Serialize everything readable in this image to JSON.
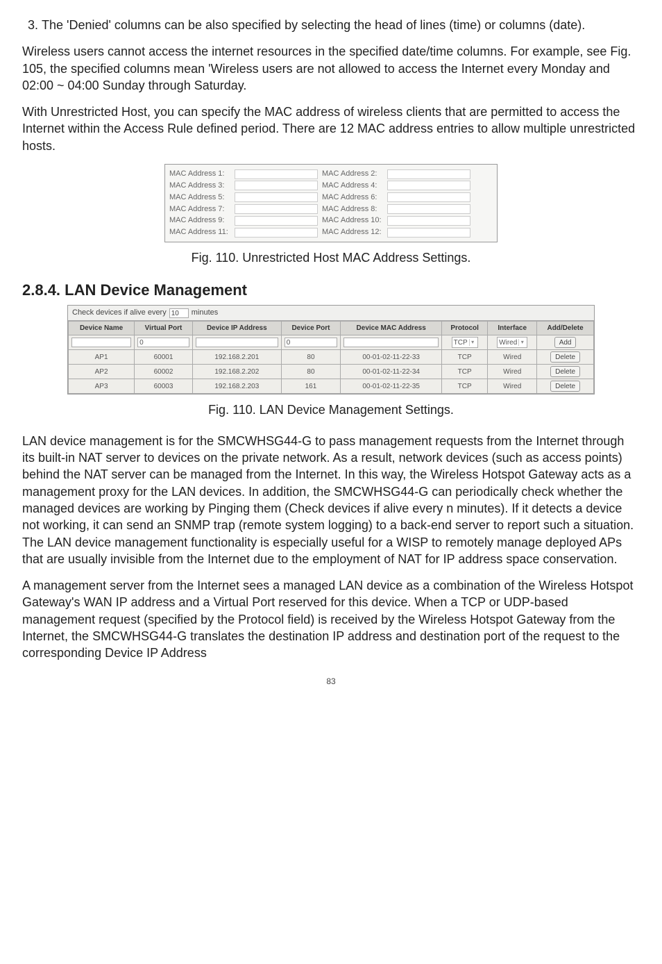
{
  "list_item_3": "The 'Denied' columns can be also specified by selecting the head of lines (time) or columns (date).",
  "para1": "Wireless users cannot access the internet resources in the specified date/time columns. For example, see Fig. 105, the specified columns mean 'Wireless users are not allowed to access the Internet every Monday and 02:00 ~ 04:00 Sunday through Saturday.",
  "para2": "With Unrestricted Host, you can specify the MAC address of wireless clients that are permitted to access the Internet within the Access Rule defined period. There are 12 MAC address entries to allow multiple unrestricted hosts.",
  "mac_labels": {
    "l1": "MAC Address 1:",
    "r1": "MAC Address 2:",
    "l2": "MAC Address 3:",
    "r2": "MAC Address 4:",
    "l3": "MAC Address 5:",
    "r3": "MAC Address 6:",
    "l4": "MAC Address 7:",
    "r4": "MAC Address 8:",
    "l5": "MAC Address 9:",
    "r5": "MAC Address 10:",
    "l6": "MAC Address 11:",
    "r6": "MAC Address 12:"
  },
  "fig110a_caption": "Fig. 110. Unrestricted Host MAC Address Settings.",
  "section_heading": "2.8.4. LAN Device Management",
  "lan_top": {
    "pre": "Check devices if alive every",
    "value": "10",
    "post": "minutes"
  },
  "lan_headers": {
    "name": "Device Name",
    "vport": "Virtual Port",
    "ip": "Device IP Address",
    "dport": "Device Port",
    "mac": "Device MAC Address",
    "proto": "Protocol",
    "iface": "Interface",
    "action": "Add/Delete"
  },
  "lan_newrow": {
    "vport": "0",
    "dport": "0",
    "proto": "TCP",
    "iface": "Wired",
    "action": "Add"
  },
  "lan_rows": [
    {
      "name": "AP1",
      "vport": "60001",
      "ip": "192.168.2.201",
      "dport": "80",
      "mac": "00-01-02-11-22-33",
      "proto": "TCP",
      "iface": "Wired",
      "action": "Delete"
    },
    {
      "name": "AP2",
      "vport": "60002",
      "ip": "192.168.2.202",
      "dport": "80",
      "mac": "00-01-02-11-22-34",
      "proto": "TCP",
      "iface": "Wired",
      "action": "Delete"
    },
    {
      "name": "AP3",
      "vport": "60003",
      "ip": "192.168.2.203",
      "dport": "161",
      "mac": "00-01-02-11-22-35",
      "proto": "TCP",
      "iface": "Wired",
      "action": "Delete"
    }
  ],
  "fig110b_caption": "Fig. 110. LAN Device Management Settings.",
  "para3": "LAN device management is for the SMCWHSG44-G to pass management requests from the Internet through its built-in NAT server to devices on the private network. As a result, network devices (such as access points) behind the NAT server can be managed from the Internet. In this way, the Wireless Hotspot Gateway acts as a management proxy for the LAN devices. In addition, the SMCWHSG44-G can periodically check whether the managed devices are working by Pinging them (Check devices if alive every n minutes). If it detects a device not working, it can send an SNMP trap (remote system logging) to a back-end server to report such a situation. The LAN device management functionality is especially useful for a WISP to remotely manage deployed APs that are usually invisible from the Internet due to the employment of NAT for IP address space conservation.",
  "para4": "A management server from the Internet sees a managed LAN device as a combination of the Wireless Hotspot Gateway's WAN IP address and a Virtual Port reserved for this device. When a TCP or UDP-based management request (specified by the Protocol field) is received by the Wireless Hotspot Gateway from the Internet, the SMCWHSG44-G translates the destination IP address and destination port of the request to the corresponding Device IP Address",
  "page_number": "83"
}
